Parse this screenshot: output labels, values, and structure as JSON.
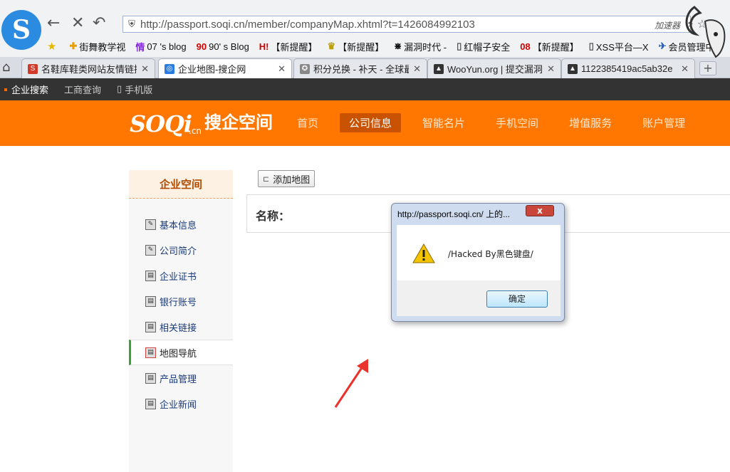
{
  "browser": {
    "url": "http://passport.soqi.cn/member/companyMap.xhtml?t=1426084992103",
    "accelerator_label": "加速器",
    "bookmarks": [
      {
        "label": "街舞教学视",
        "color": "#e8a000",
        "icon": "bookmark-icon"
      },
      {
        "label": "07 's blog",
        "color": "#8a2be2",
        "icon": "blog-icon"
      },
      {
        "label": "90' s Blog",
        "color": "#d00000",
        "icon": "blog-icon"
      },
      {
        "label": "【新提醒】",
        "color": "#d00000",
        "icon": "alert-icon"
      },
      {
        "label": "【新提醒】",
        "color": "#c0a000",
        "icon": "crown-icon"
      },
      {
        "label": "漏洞时代 -",
        "color": "#000000",
        "icon": "grid-icon"
      },
      {
        "label": "红帽子安全",
        "color": "#555555",
        "icon": "page-icon"
      },
      {
        "label": "【新提醒】",
        "color": "#d00000",
        "icon": "number-icon"
      },
      {
        "label": "XSS平台—X",
        "color": "#555555",
        "icon": "page-icon"
      },
      {
        "label": "会员管理中",
        "color": "#2060c0",
        "icon": "bird-icon"
      }
    ],
    "bookmark_prefixes": [
      "",
      "",
      "90",
      "",
      "",
      "",
      "",
      "08",
      "",
      ""
    ],
    "tabs": [
      {
        "label": "名鞋库鞋类网站友情链接",
        "fav_color": "#d03a2a",
        "fav_text": "S"
      },
      {
        "label": "企业地图-搜企网",
        "fav_color": "#2b7ce0",
        "fav_text": "◎"
      },
      {
        "label": "积分兑换 - 补天 - 全球最",
        "fav_color": "#888888",
        "fav_text": "✪"
      },
      {
        "label": "WooYun.org | 提交漏洞",
        "fav_color": "#333333",
        "fav_text": "▲"
      },
      {
        "label": "1122385419ac5ab32e",
        "fav_color": "#333333",
        "fav_text": "▲"
      }
    ]
  },
  "site": {
    "topbar": [
      "企业搜索",
      "工商查询",
      "手机版"
    ],
    "brand": {
      "logo_text": "SOQi",
      "cn": ".cn",
      "name": "搜企空间"
    },
    "nav": [
      "首页",
      "公司信息",
      "智能名片",
      "手机空间",
      "增值服务",
      "账户管理"
    ],
    "nav_active_index": 1,
    "sidebar_title": "企业空间",
    "sidebar_items": [
      "基本信息",
      "公司简介",
      "企业证书",
      "银行账号",
      "相关链接",
      "地图导航",
      "产品管理",
      "企业新闻"
    ],
    "sidebar_active_index": 5,
    "add_map_button": "添加地图",
    "name_label": "名称："
  },
  "dialog": {
    "title": "http://passport.soqi.cn/ 上的...",
    "message": "/Hacked By黑色键盘/",
    "ok_label": "确定",
    "close_label": "x"
  },
  "colors": {
    "brand_orange": "#ff7700",
    "active_nav": "#c85200",
    "arrow": "#e8322b"
  }
}
